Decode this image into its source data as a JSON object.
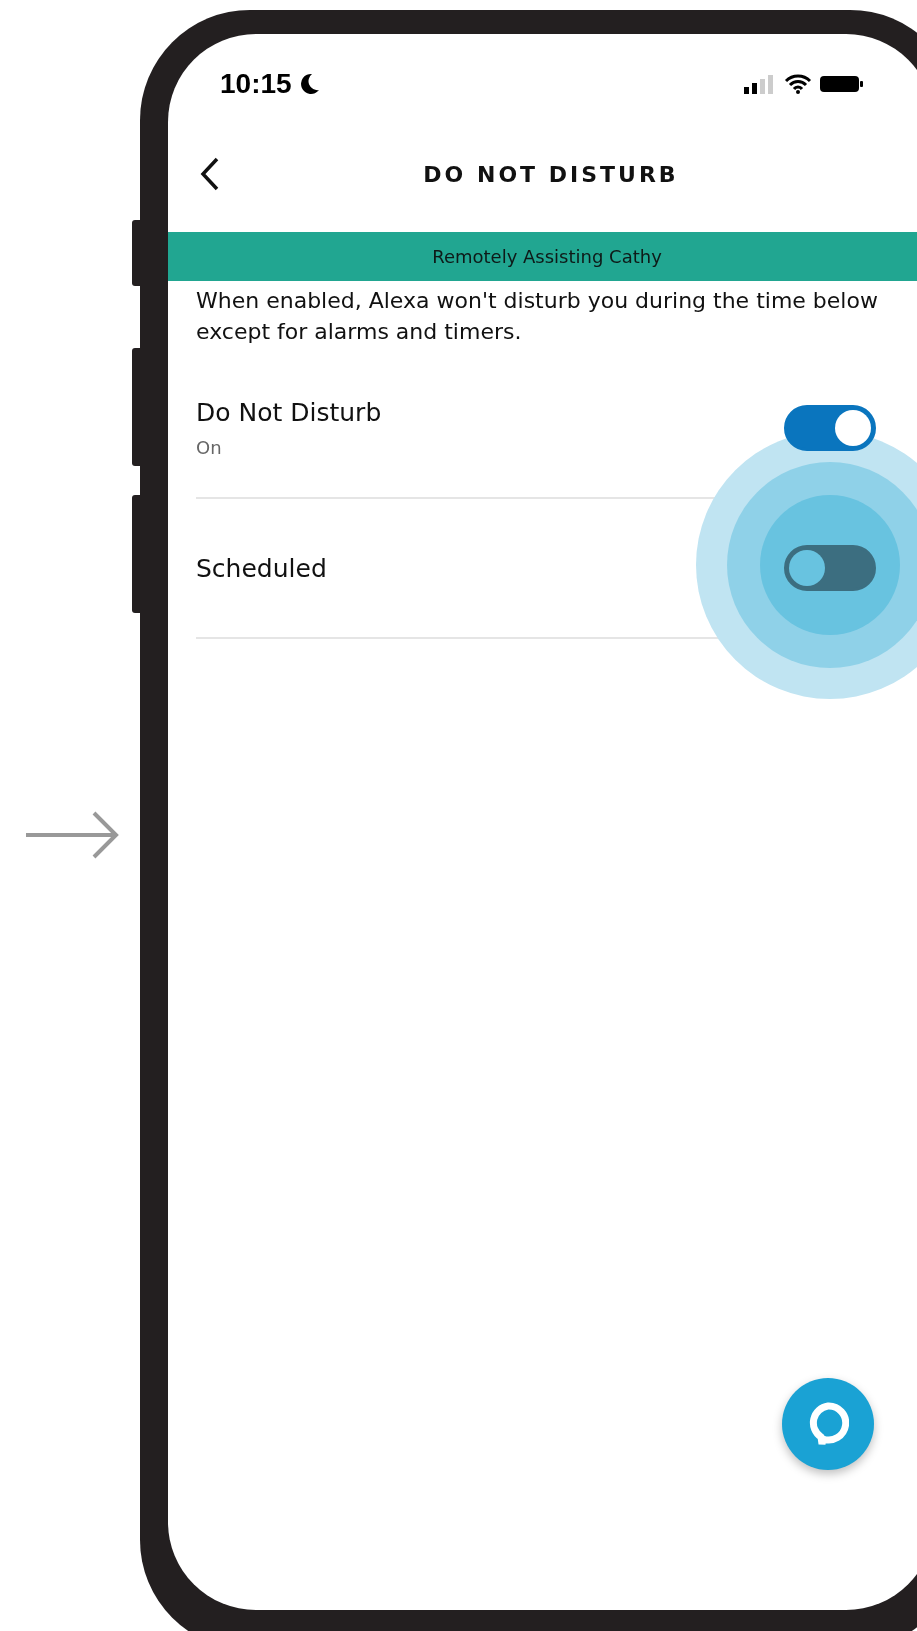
{
  "status_bar": {
    "time": "10:15"
  },
  "header": {
    "title": "DO NOT DISTURB"
  },
  "banner": {
    "text": "Remotely Assisting Cathy"
  },
  "description": "When enabled, Alexa won't disturb you during the time below except for alarms and timers.",
  "settings": [
    {
      "label": "Do Not Disturb",
      "status": "On",
      "on": true,
      "tapped": false
    },
    {
      "label": "Scheduled",
      "on": false,
      "tapped": true
    }
  ]
}
